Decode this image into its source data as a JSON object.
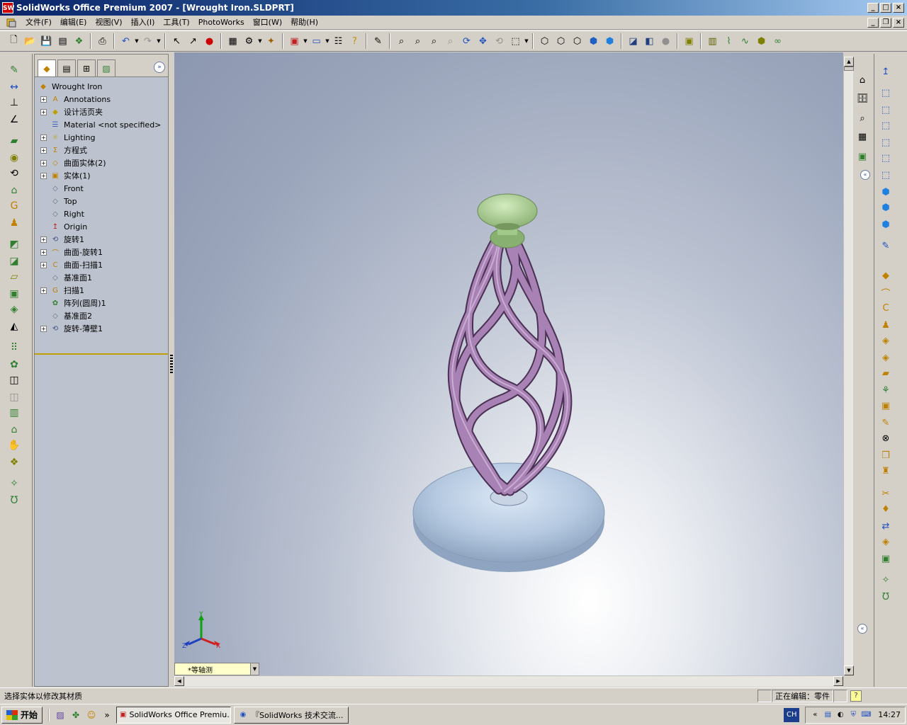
{
  "window": {
    "title": "SolidWorks Office Premium 2007 - [Wrought Iron.SLDPRT]",
    "app_icon": "SW"
  },
  "menu": {
    "items": [
      "文件(F)",
      "编辑(E)",
      "视图(V)",
      "插入(I)",
      "工具(T)",
      "PhotoWorks",
      "窗口(W)",
      "帮助(H)"
    ]
  },
  "tree": {
    "root": "Wrought Iron",
    "items": [
      {
        "label": "Annotations",
        "expand": "+",
        "icon": "annotations-icon",
        "glyph": "A"
      },
      {
        "label": "设计活页夹",
        "expand": "+",
        "icon": "design-binder-icon",
        "glyph": "◆"
      },
      {
        "label": "Material <not specified>",
        "expand": "",
        "icon": "material-icon",
        "glyph": "☰"
      },
      {
        "label": "Lighting",
        "expand": "+",
        "icon": "lighting-icon",
        "glyph": "☼"
      },
      {
        "label": "方程式",
        "expand": "+",
        "icon": "equations-icon",
        "glyph": "Σ"
      },
      {
        "label": "曲面实体(2)",
        "expand": "+",
        "icon": "surface-bodies-icon",
        "glyph": "◇"
      },
      {
        "label": "实体(1)",
        "expand": "+",
        "icon": "solid-bodies-icon",
        "glyph": "▣"
      },
      {
        "label": "Front",
        "expand": "",
        "icon": "plane-icon",
        "glyph": "◇"
      },
      {
        "label": "Top",
        "expand": "",
        "icon": "plane-icon",
        "glyph": "◇"
      },
      {
        "label": "Right",
        "expand": "",
        "icon": "plane-icon",
        "glyph": "◇"
      },
      {
        "label": "Origin",
        "expand": "",
        "icon": "origin-icon",
        "glyph": "↥"
      },
      {
        "label": "旋转1",
        "expand": "+",
        "icon": "revolve-icon",
        "glyph": "⟲"
      },
      {
        "label": "曲面-旋转1",
        "expand": "+",
        "icon": "surface-revolve-icon",
        "glyph": "⌒"
      },
      {
        "label": "曲面-扫描1",
        "expand": "+",
        "icon": "surface-sweep-icon",
        "glyph": "C"
      },
      {
        "label": "基准面1",
        "expand": "",
        "icon": "plane-icon",
        "glyph": "◇"
      },
      {
        "label": "扫描1",
        "expand": "+",
        "icon": "sweep-icon",
        "glyph": "G"
      },
      {
        "label": "阵列(圆周)1",
        "expand": "",
        "icon": "circular-pattern-icon",
        "glyph": "✿"
      },
      {
        "label": "基准面2",
        "expand": "",
        "icon": "plane-icon",
        "glyph": "◇"
      },
      {
        "label": "旋转-薄壁1",
        "expand": "+",
        "icon": "revolve-thin-icon",
        "glyph": "⟲"
      }
    ]
  },
  "viewport": {
    "view_orientation": "*等轴测",
    "triad": {
      "x": "X",
      "y": "Y",
      "z": "Z"
    }
  },
  "status": {
    "message": "选择实体以修改其材质",
    "mode": "正在编辑：零件",
    "help": "?"
  },
  "taskbar": {
    "start_label": "开始",
    "more": "»",
    "tasks": [
      {
        "label": "SolidWorks Office Premiu...",
        "active": true,
        "icon": "solidworks-icon"
      },
      {
        "label": "『SolidWorks 技术交流...",
        "active": false,
        "icon": "browser-icon"
      }
    ],
    "ime": "CH",
    "tray_expand": "«",
    "clock": "14:27"
  },
  "colors": {
    "model_base": "#b4c8e0",
    "model_cap": "#a8d08c",
    "model_twist": "#9e7ca8",
    "title_gradient_start": "#0a246a"
  }
}
